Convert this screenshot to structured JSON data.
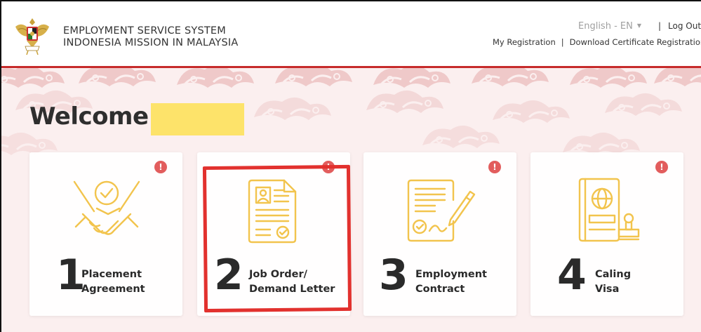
{
  "header": {
    "brand_line1": "EMPLOYMENT SERVICE SYSTEM",
    "brand_line2": "INDONESIA MISSION IN MALAYSIA",
    "language": "English - EN",
    "logout": "Log Out",
    "my_registration": "My Registration",
    "download_certificate": "Download Certificate Registration",
    "separator": "|"
  },
  "hero": {
    "welcome": "Welcome"
  },
  "cards": [
    {
      "number": "1",
      "line1": "Placement",
      "line2": "Agreement",
      "icon": "handshake-icon"
    },
    {
      "number": "2",
      "line1": "Job Order/",
      "line2": "Demand Letter",
      "icon": "document-icon"
    },
    {
      "number": "3",
      "line1": "Employment",
      "line2": "Contract",
      "icon": "contract-icon"
    },
    {
      "number": "4",
      "line1": "Caling",
      "line2": "Visa",
      "icon": "passport-icon"
    }
  ],
  "alert_glyph": "!",
  "colors": {
    "accent_red": "#c62b2b",
    "icon_gold": "#f2c44d",
    "alert_red": "#e25d5d",
    "highlight_red": "#e2312e",
    "name_mask": "#fde36a"
  }
}
